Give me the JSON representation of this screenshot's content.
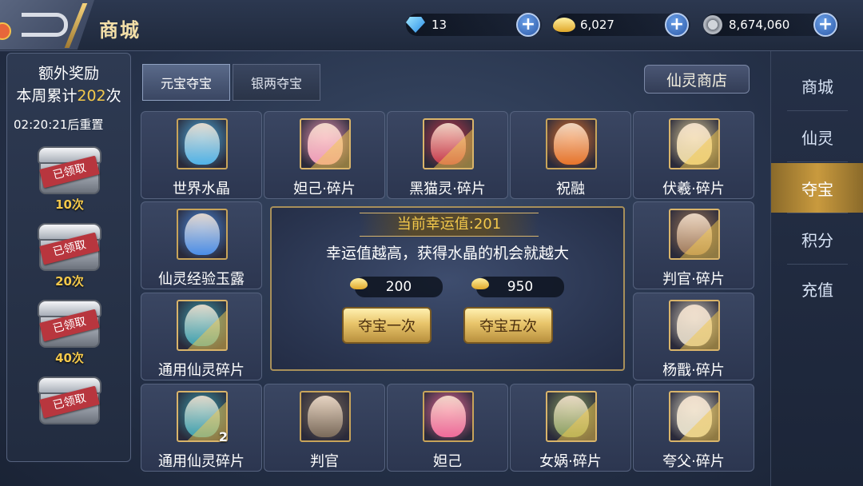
{
  "header": {
    "title": "商城",
    "currencies": [
      {
        "icon": "diamond-icon",
        "value": "13"
      },
      {
        "icon": "gold-ingot-icon",
        "value": "6,027"
      },
      {
        "icon": "silver-coin-icon",
        "value": "8,674,060"
      }
    ]
  },
  "rewards": {
    "title": "额外奖励",
    "weekly_prefix": "本周累计",
    "weekly_count": "202",
    "weekly_suffix": "次",
    "reset_text": "02:20:21后重置",
    "claimed_label": "已领取",
    "items": [
      {
        "count": "10次"
      },
      {
        "count": "20次"
      },
      {
        "count": "40次"
      },
      {
        "count": ""
      }
    ]
  },
  "tabs": [
    {
      "label": "元宝夺宝",
      "active": true
    },
    {
      "label": "银两夺宝",
      "active": false
    }
  ],
  "spirit_shop_label": "仙灵商店",
  "grid": [
    {
      "name": "世界水晶",
      "icon": "crystal-icon",
      "color": "#4fb3e8"
    },
    {
      "name": "妲己·碎片",
      "icon": "daji-portrait-icon",
      "color": "#f09ab8"
    },
    {
      "name": "黑猫灵·碎片",
      "icon": "black-cat-portrait-icon",
      "color": "#c8384a"
    },
    {
      "name": "祝融",
      "icon": "zhurong-portrait-icon",
      "color": "#e8742a"
    },
    {
      "name": "伏羲·碎片",
      "icon": "fuxi-portrait-icon",
      "color": "#e8d6a0"
    },
    {
      "name": "仙灵经验玉露",
      "icon": "potion-icon",
      "color": "#4a8ee8"
    },
    {
      "name": "判官·碎片",
      "icon": "judge-portrait-icon",
      "color": "#a07a5a"
    },
    {
      "name": "通用仙灵碎片",
      "icon": "spirit-fragment-icon",
      "color": "#3aa0b0"
    },
    {
      "name": "杨戬·碎片",
      "icon": "yangjian-portrait-icon",
      "color": "#d8d0c0"
    },
    {
      "name": "通用仙灵碎片",
      "icon": "spirit-fragment-icon",
      "color": "#3aa0b0",
      "qty": "2"
    },
    {
      "name": "判官",
      "icon": "judge-portrait-icon",
      "color": "#7a6a5a"
    },
    {
      "name": "妲己",
      "icon": "daji-portrait-icon",
      "color": "#f06a9a"
    },
    {
      "name": "女娲·碎片",
      "icon": "nuwa-portrait-icon",
      "color": "#8aa060"
    },
    {
      "name": "夸父·碎片",
      "icon": "kuafu-portrait-icon",
      "color": "#e0dcc8"
    }
  ],
  "luck": {
    "title": "当前幸运值:201",
    "description": "幸运值越高，获得水晶的机会就越大",
    "single_cost": "200",
    "five_cost": "950",
    "single_label": "夺宝一次",
    "five_label": "夺宝五次"
  },
  "nav": [
    {
      "label": "商城",
      "active": false
    },
    {
      "label": "仙灵",
      "active": false
    },
    {
      "label": "夺宝",
      "active": true
    },
    {
      "label": "积分",
      "active": false
    },
    {
      "label": "充值",
      "active": false
    }
  ],
  "colors": {
    "accent_gold": "#f3c84b",
    "claimed_red": "#b8363e",
    "nav_active": "#c99a3e"
  }
}
